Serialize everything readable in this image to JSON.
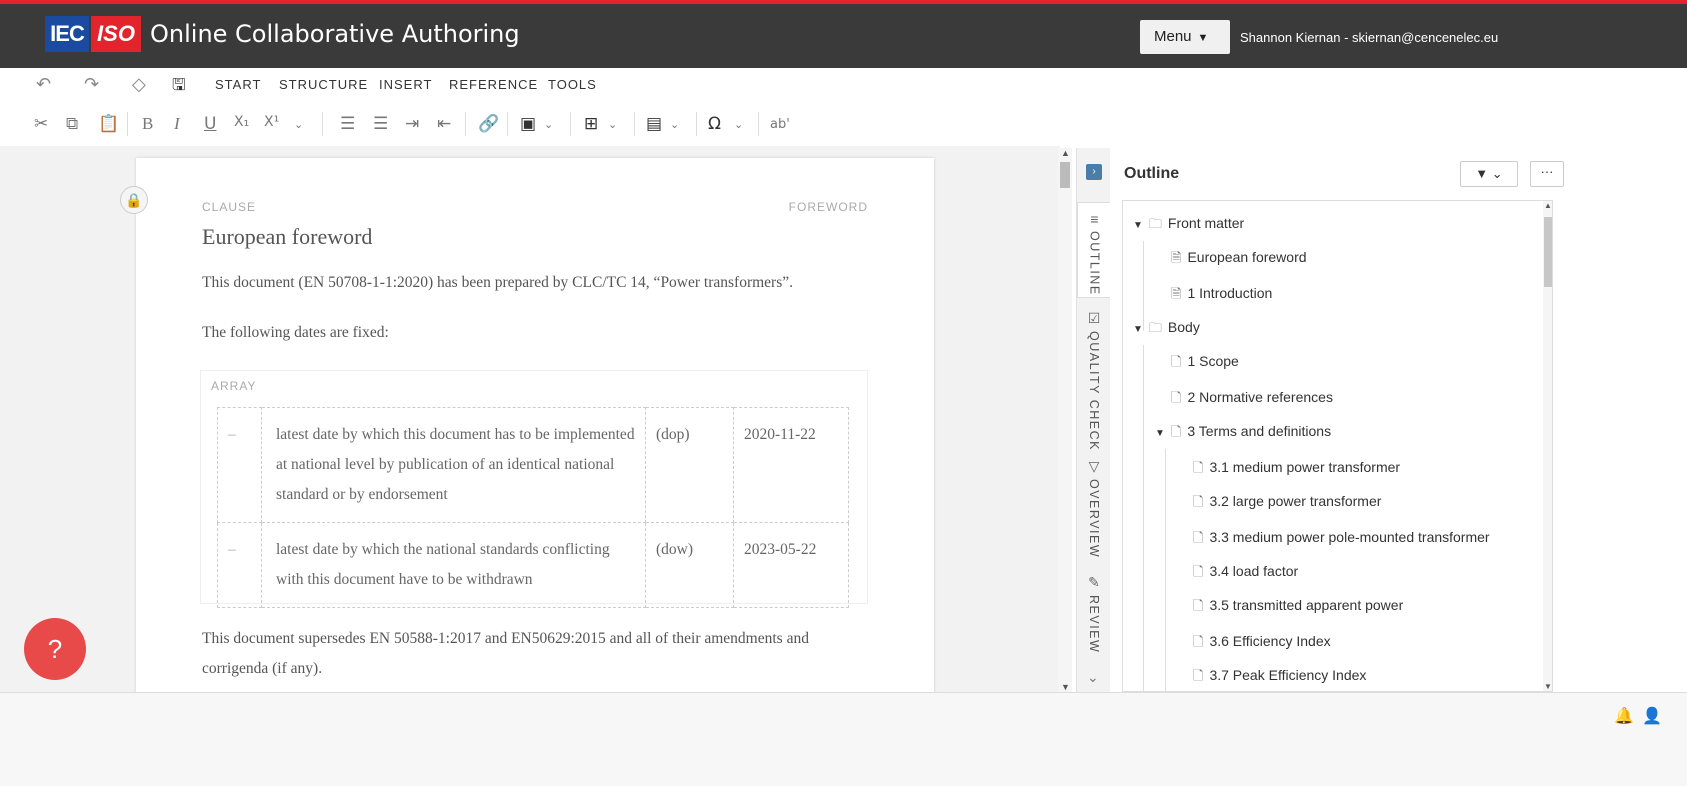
{
  "app": {
    "title": "Online Collaborative Authoring",
    "logo_left": "IEC",
    "logo_right": "ISO",
    "menu_label": "Menu",
    "user": "Shannon Kiernan - skiernan@cencenelec.eu",
    "brand_red": "#e2242c",
    "brand_blue": "#1a4ba0"
  },
  "toolbar": {
    "tabs": [
      "START",
      "STRUCTURE",
      "INSERT",
      "REFERENCE",
      "TOOLS"
    ],
    "icons": [
      "undo-icon",
      "redo-icon",
      "eraser-icon",
      "save-icon"
    ]
  },
  "format_toolbar": {
    "superscript_extra": "ab'",
    "bold": "B",
    "italic": "I",
    "underline": "U"
  },
  "document": {
    "clause_label": "CLAUSE",
    "section_label": "FOREWORD",
    "heading": "European foreword",
    "para1": "This document (EN 50708-1-1:2020) has been prepared by CLC/TC 14, “Power transformers”.",
    "para2": "The following dates are fixed:",
    "array_label": "ARRAY",
    "rows": [
      {
        "dash": "–",
        "text": "latest date by which this document has to be implemented at national level by publication of an identical national standard or by endorsement",
        "code": "(dop)",
        "date": "2020-11-22"
      },
      {
        "dash": "–",
        "text": "latest date by which the national standards conflicting with this document have to be withdrawn",
        "code": "(dow)",
        "date": "2023-05-22"
      }
    ],
    "para3_line1": "This document supersedes EN 50588-1:2017 and EN50629:2015 and all of their amendments and",
    "para3_line2": "corrigenda (if any)."
  },
  "help_label": "?",
  "side_tabs": [
    "OUTLINE",
    "QUALITY CHECK",
    "OVERVIEW",
    "REVIEW"
  ],
  "outline": {
    "title": "Outline",
    "items": [
      {
        "label": "Front matter"
      },
      {
        "label": "European foreword"
      },
      {
        "label": "1 Introduction"
      },
      {
        "label": "Body"
      },
      {
        "label": "1 Scope"
      },
      {
        "label": "2 Normative references"
      },
      {
        "label": "3 Terms and definitions"
      },
      {
        "label": "3.1 medium power transformer"
      },
      {
        "label": "3.2 large power transformer"
      },
      {
        "label": "3.3 medium power pole-mounted transformer"
      },
      {
        "label": "3.4 load factor"
      },
      {
        "label": "3.5 transmitted apparent power"
      },
      {
        "label": "3.6 Efficiency Index"
      },
      {
        "label": "3.7 Peak Efficiency Index"
      }
    ]
  }
}
